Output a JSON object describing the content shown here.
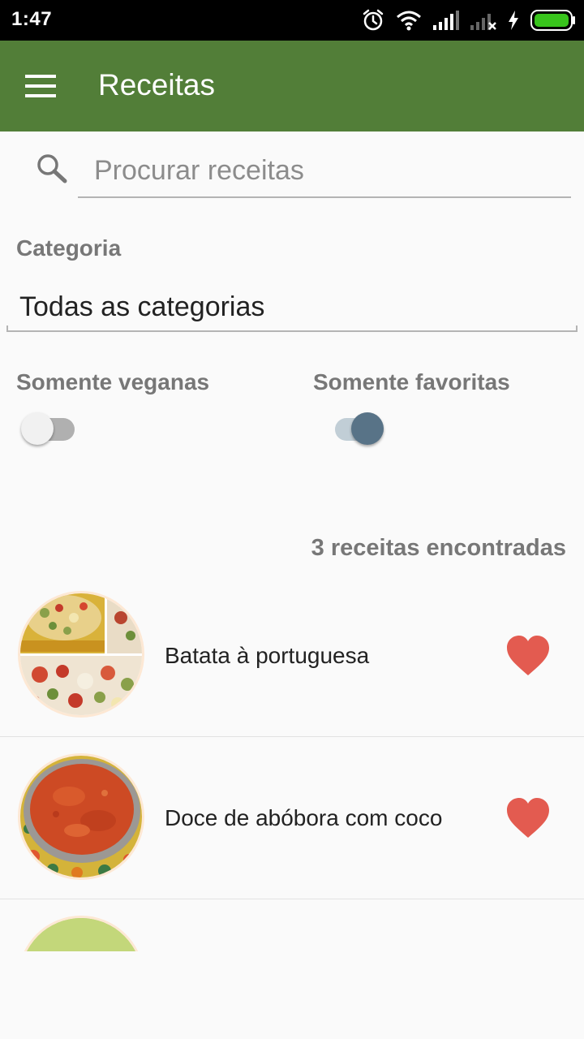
{
  "status_bar": {
    "time": "1:47",
    "icons": [
      "alarm-icon",
      "wifi-icon",
      "signal-icon",
      "no-signal-icon",
      "charging-icon",
      "battery-icon"
    ],
    "battery_color": "#38c41c"
  },
  "app_bar": {
    "title": "Receitas",
    "color": "#527e38",
    "menu_icon": "hamburger-menu-icon"
  },
  "search": {
    "placeholder": "Procurar receitas",
    "value": ""
  },
  "category": {
    "label": "Categoria",
    "selected": "Todas as categorias"
  },
  "filters": {
    "vegan_label": "Somente veganas",
    "vegan_on": false,
    "favorites_label": "Somente favoritas",
    "favorites_on": true
  },
  "results": {
    "count_text": "3 receitas encontradas"
  },
  "recipes": [
    {
      "name": "Batata à portuguesa",
      "favorite": true
    },
    {
      "name": "Doce de abóbora com coco",
      "favorite": true
    },
    {
      "name": "",
      "favorite": false
    }
  ],
  "colors": {
    "heart": "#e35b50",
    "toggle_on": "#587387",
    "secondary_text": "#777777"
  }
}
